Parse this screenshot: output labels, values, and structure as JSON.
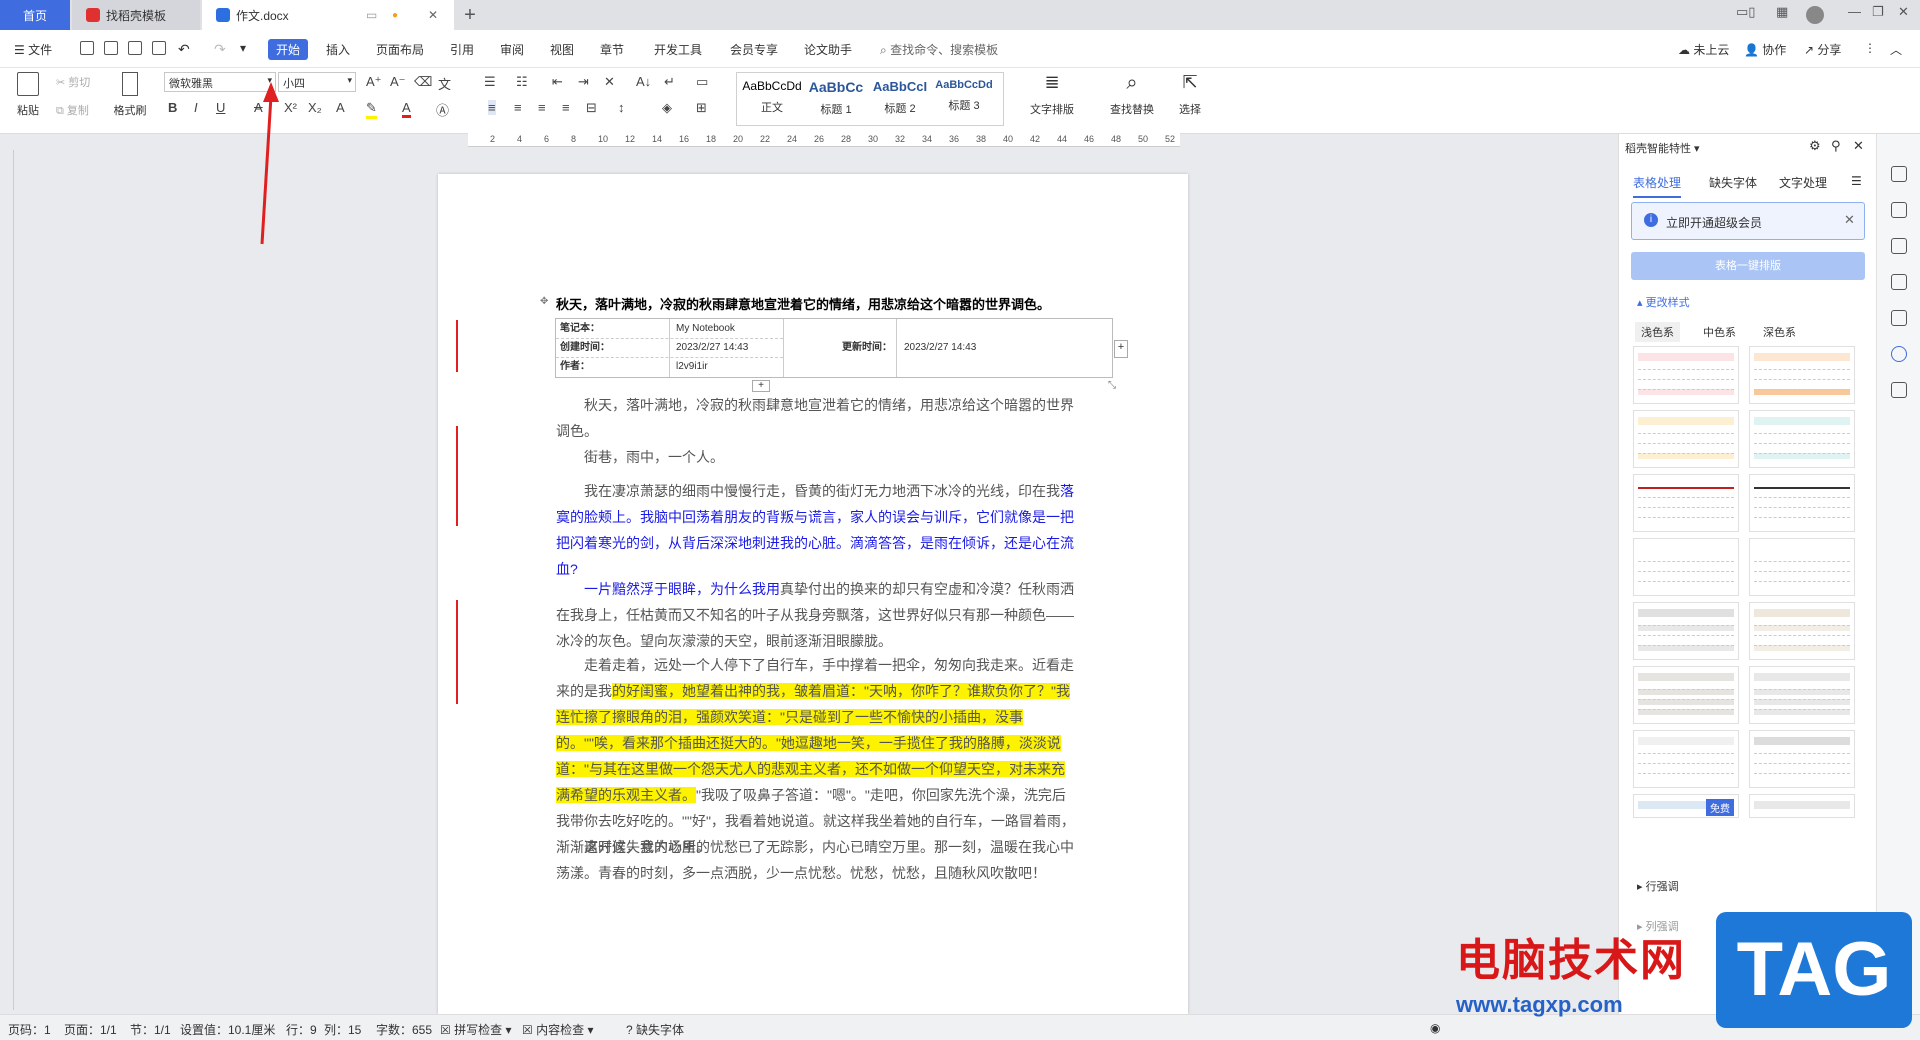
{
  "tabs": {
    "home": "首页",
    "find_template": "找稻壳模板",
    "document": "作文.docx"
  },
  "menu": {
    "file": "文件",
    "items": [
      "开始",
      "插入",
      "页面布局",
      "引用",
      "审阅",
      "视图",
      "章节",
      "开发工具",
      "会员专享",
      "论文助手"
    ],
    "search": "查找命令、搜索模板",
    "cloud": "未上云",
    "collab": "协作",
    "share": "分享"
  },
  "ribbon": {
    "paste": "粘贴",
    "cut": "剪切",
    "copy": "复制",
    "format_painter": "格式刷",
    "font_name": "微软雅黑",
    "font_size": "小四",
    "styles": [
      {
        "preview": "AaBbCcDd",
        "label": "正文"
      },
      {
        "preview": "AaBbCc",
        "label": "标题 1"
      },
      {
        "preview": "AaBbCcI",
        "label": "标题 2"
      },
      {
        "preview": "AaBbCcDd",
        "label": "标题 3"
      }
    ],
    "text_layout": "文字排版",
    "find_replace": "查找替换",
    "select": "选择"
  },
  "ruler": [
    "2",
    "4",
    "6",
    "8",
    "10",
    "12",
    "14",
    "16",
    "18",
    "20",
    "22",
    "24",
    "26",
    "28",
    "30",
    "32",
    "34",
    "36",
    "38",
    "40",
    "42",
    "44",
    "46",
    "48",
    "50",
    "52"
  ],
  "document": {
    "heading": "秋天，落叶满地，冷寂的秋雨肆意地宣泄着它的情绪，用悲凉给这个暗嚣的世界调色。",
    "note_table": {
      "notebook_label": "笔记本：",
      "notebook_value": "My Notebook",
      "created_label": "创建时间：",
      "created_value": "2023/2/27 14:43",
      "updated_label": "更新时间：",
      "updated_value": "2023/2/27 14:43",
      "author_label": "作者：",
      "author_value": "l2v9i1ir"
    },
    "p1": "秋天，落叶满地，冷寂的秋雨肆意地宣泄着它的情绪，用悲凉给这个暗嚣的世界调色。",
    "p2": "街巷，雨中，一个人。",
    "p3a": "我在凄凉萧瑟的细雨中慢慢行走，昏黄的街灯无力地洒下冰冷的光线，印在我",
    "p3b": "落寞的脸颊上。我脑中回荡着朋友的背叛与谎言，家人的误会与训斥，它们就像是一把把闪着寒光的剑，从背后深深地刺进我的心脏。滴滴答答，是雨在倾诉，还是心在流血?",
    "p4a": "一片黯然浮于眼眸，为什么我用",
    "p4b": "真挚付出的换来的却只有空虚和冷漠？任秋雨洒在我身上，任枯黄而又不知名的叶子从我身旁飘落，这世界好似只有那一种颜色——冰冷的灰色。望向灰濛濛的天空，眼前逐渐泪眼朦胧。",
    "p5a": "走着走着，远处一个人停下了自行车，手中撑着一把伞，匆匆向我走来。近看走来的是我",
    "p5b": "的好闺蜜，她望着出神的我，皱着眉道：\"天呐，你咋了？谁欺负你了？\"我连忙擦了擦眼角的泪，强颜欢笑道：\"只是碰到了一些不愉快的小插曲，没事的。\"\"唉，看来那个插曲还挺大的。\"她逗趣地一笑，一手揽住了我的胳膊，淡淡说道：\"与其在这里做一个怨天尤人的悲观主义者，还不如做一个仰望天空，对未来充满希望的乐观主义者。",
    "p5c": "\"我吸了吸鼻子答道：\"嗯\"。\"走吧，你回家先洗个澡，洗完后我带你去吃好吃的。\"\"好\"，我看着她说道。就这样我坐着她的自行车，一路冒着雨，渐渐离开这失意的场所。",
    "p6": "这时候，我内心里的忧愁已了无踪影，内心已晴空万里。那一刻，温暖在我心中荡漾。青春的时刻，多一点洒脱，少一点忧愁。忧愁，忧愁，且随秋风吹散吧！"
  },
  "panel": {
    "title": "稻壳智能特性",
    "tabs": [
      "表格处理",
      "缺失字体",
      "文字处理"
    ],
    "vip_notice": "立即开通超级会员",
    "one_click": "表格一键排版",
    "change_style": "更改样式",
    "color_tabs": [
      "浅色系",
      "中色系",
      "深色系"
    ],
    "free_badge": "免费",
    "row_adjust": "行强调",
    "col_adjust": "列强调"
  },
  "status": {
    "page_code": "页码：1",
    "page": "页面：1/1",
    "section": "节：1/1",
    "setting": "设置值：10.1厘米",
    "row": "行：9",
    "col": "列：15",
    "word_count": "字数：655",
    "spell_check": "拼写检查",
    "content_check": "内容检查",
    "missing_font": "缺失字体"
  },
  "watermark": {
    "site_name": "电脑技术网",
    "url": "www.tagxp.com",
    "tag": "TAG"
  },
  "colors": {
    "accent": "#3f6de0",
    "highlight": "#fdf300",
    "blue_text": "#1a1ae6",
    "arrow": "#e02020"
  }
}
